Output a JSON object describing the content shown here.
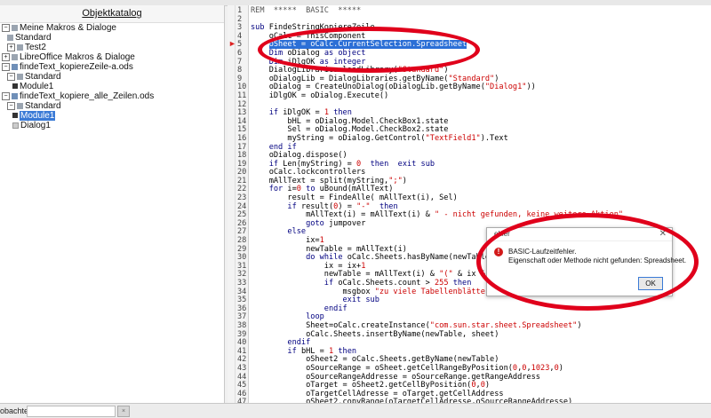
{
  "object_catalog": {
    "title": "Objektkatalog",
    "items": [
      {
        "label": "Meine Makros & Dialoge",
        "level": 0,
        "exp": "−",
        "icon": "folder-icon",
        "selected": false
      },
      {
        "label": "Standard",
        "level": 1,
        "exp": "",
        "icon": "library-icon",
        "selected": false
      },
      {
        "label": "Test2",
        "level": 1,
        "exp": "+",
        "icon": "library-icon",
        "selected": false
      },
      {
        "label": "LibreOffice Makros & Dialoge",
        "level": 0,
        "exp": "+",
        "icon": "folder-icon",
        "selected": false
      },
      {
        "label": "findeText_kopiereZeile-a.ods",
        "level": 0,
        "exp": "−",
        "icon": "document-icon",
        "selected": false
      },
      {
        "label": "Standard",
        "level": 1,
        "exp": "−",
        "icon": "library-icon",
        "selected": false
      },
      {
        "label": "Module1",
        "level": 2,
        "exp": "",
        "icon": "module-icon",
        "selected": false
      },
      {
        "label": "findeText_kopiere_alle_Zeilen.ods",
        "level": 0,
        "exp": "−",
        "icon": "document-icon",
        "selected": false
      },
      {
        "label": "Standard",
        "level": 1,
        "exp": "−",
        "icon": "library-icon",
        "selected": false
      },
      {
        "label": "Module1",
        "level": 2,
        "exp": "",
        "icon": "module-icon",
        "selected": true
      },
      {
        "label": "Dialog1",
        "level": 2,
        "exp": "",
        "icon": "dialog-icon",
        "selected": false
      }
    ]
  },
  "editor": {
    "current_line": 5,
    "lines": [
      "REM  *****  BASIC  *****",
      "",
      "sub FindeStringKopiereZeile",
      "    oCalc = ThisComponent",
      "    oSheet = oCalc.CurrentSelection.Spreadsheet",
      "    Dim oDialog as object",
      "    Dim iDlgOK as integer",
      "    DialogLibraries.loadLibrary(\"Standard\")",
      "    oDialogLib = DialogLibraries.getByName(\"Standard\")",
      "    oDialog = CreateUnoDialog(oDialogLib.getByName(\"Dialog1\"))",
      "    iDlgOK = oDialog.Execute()",
      "",
      "    if iDlgOK = 1 then",
      "        bHL = oDialog.Model.CheckBox1.state",
      "        Sel = oDialog.Model.CheckBox2.state",
      "        myString = oDialog.GetControl(\"TextField1\").Text",
      "    end if",
      "    oDialog.dispose()",
      "    if Len(myString) = 0  then  exit sub",
      "    oCalc.lockcontrollers",
      "    mAllText = split(myString,\";\")",
      "    for i=0 to uBound(mAllText)",
      "        result = FindeAlle( mAllText(i), Sel)",
      "        if result(0) = \"-\"  then",
      "            mAllText(i) = mAllText(i) & \" - nicht gefunden, keine weitere Aktion\"",
      "            goto jumpover",
      "        else",
      "            ix=1",
      "            newTable = mAllText(i)",
      "            do while oCalc.Sheets.hasByName(newTable)",
      "                ix = ix+1",
      "                newTable = mAllText(i) & \"(\" & ix & \")\"",
      "                if oCalc.Sheets.count > 255 then",
      "                    msgbox \"zu viele Tabellenblätter\"",
      "                    exit sub",
      "                endif",
      "            loop",
      "            Sheet=oCalc.createInstance(\"com.sun.star.sheet.Spreadsheet\")",
      "            oCalc.Sheets.insertByName(newTable, sheet)",
      "        endif",
      "        if bHL = 1 then",
      "            oSheet2 = oCalc.Sheets.getByName(newTable)",
      "            oSourceRange = oSheet.getCellRangeByPosition(0,0,1023,0)",
      "            oSourceRangeAddresse = oSourceRange.getRangeAddress",
      "            oTarget = oSheet2.getCellByPosition(0,0)",
      "            oTargetCellAdresse = oTarget.getCellAddress",
      "            oSheet2.copyRange(oTargetCellAdresse,oSourceRangeAddresse)"
    ]
  },
  "error_dialog": {
    "title": "ehler",
    "close_glyph": "✕",
    "icon": "error-icon",
    "message_line1": "BASIC-Laufzeitfehler.",
    "message_line2": "Eigenschaft oder Methode nicht gefunden: Spreadsheet.",
    "ok_label": "OK"
  },
  "watch_bar": {
    "label": "obachter:",
    "button_glyph": "×"
  },
  "colors": {
    "annotation_red": "#e0001b",
    "selection_blue": "#3a7ad6",
    "error_red": "#d21a1a"
  }
}
